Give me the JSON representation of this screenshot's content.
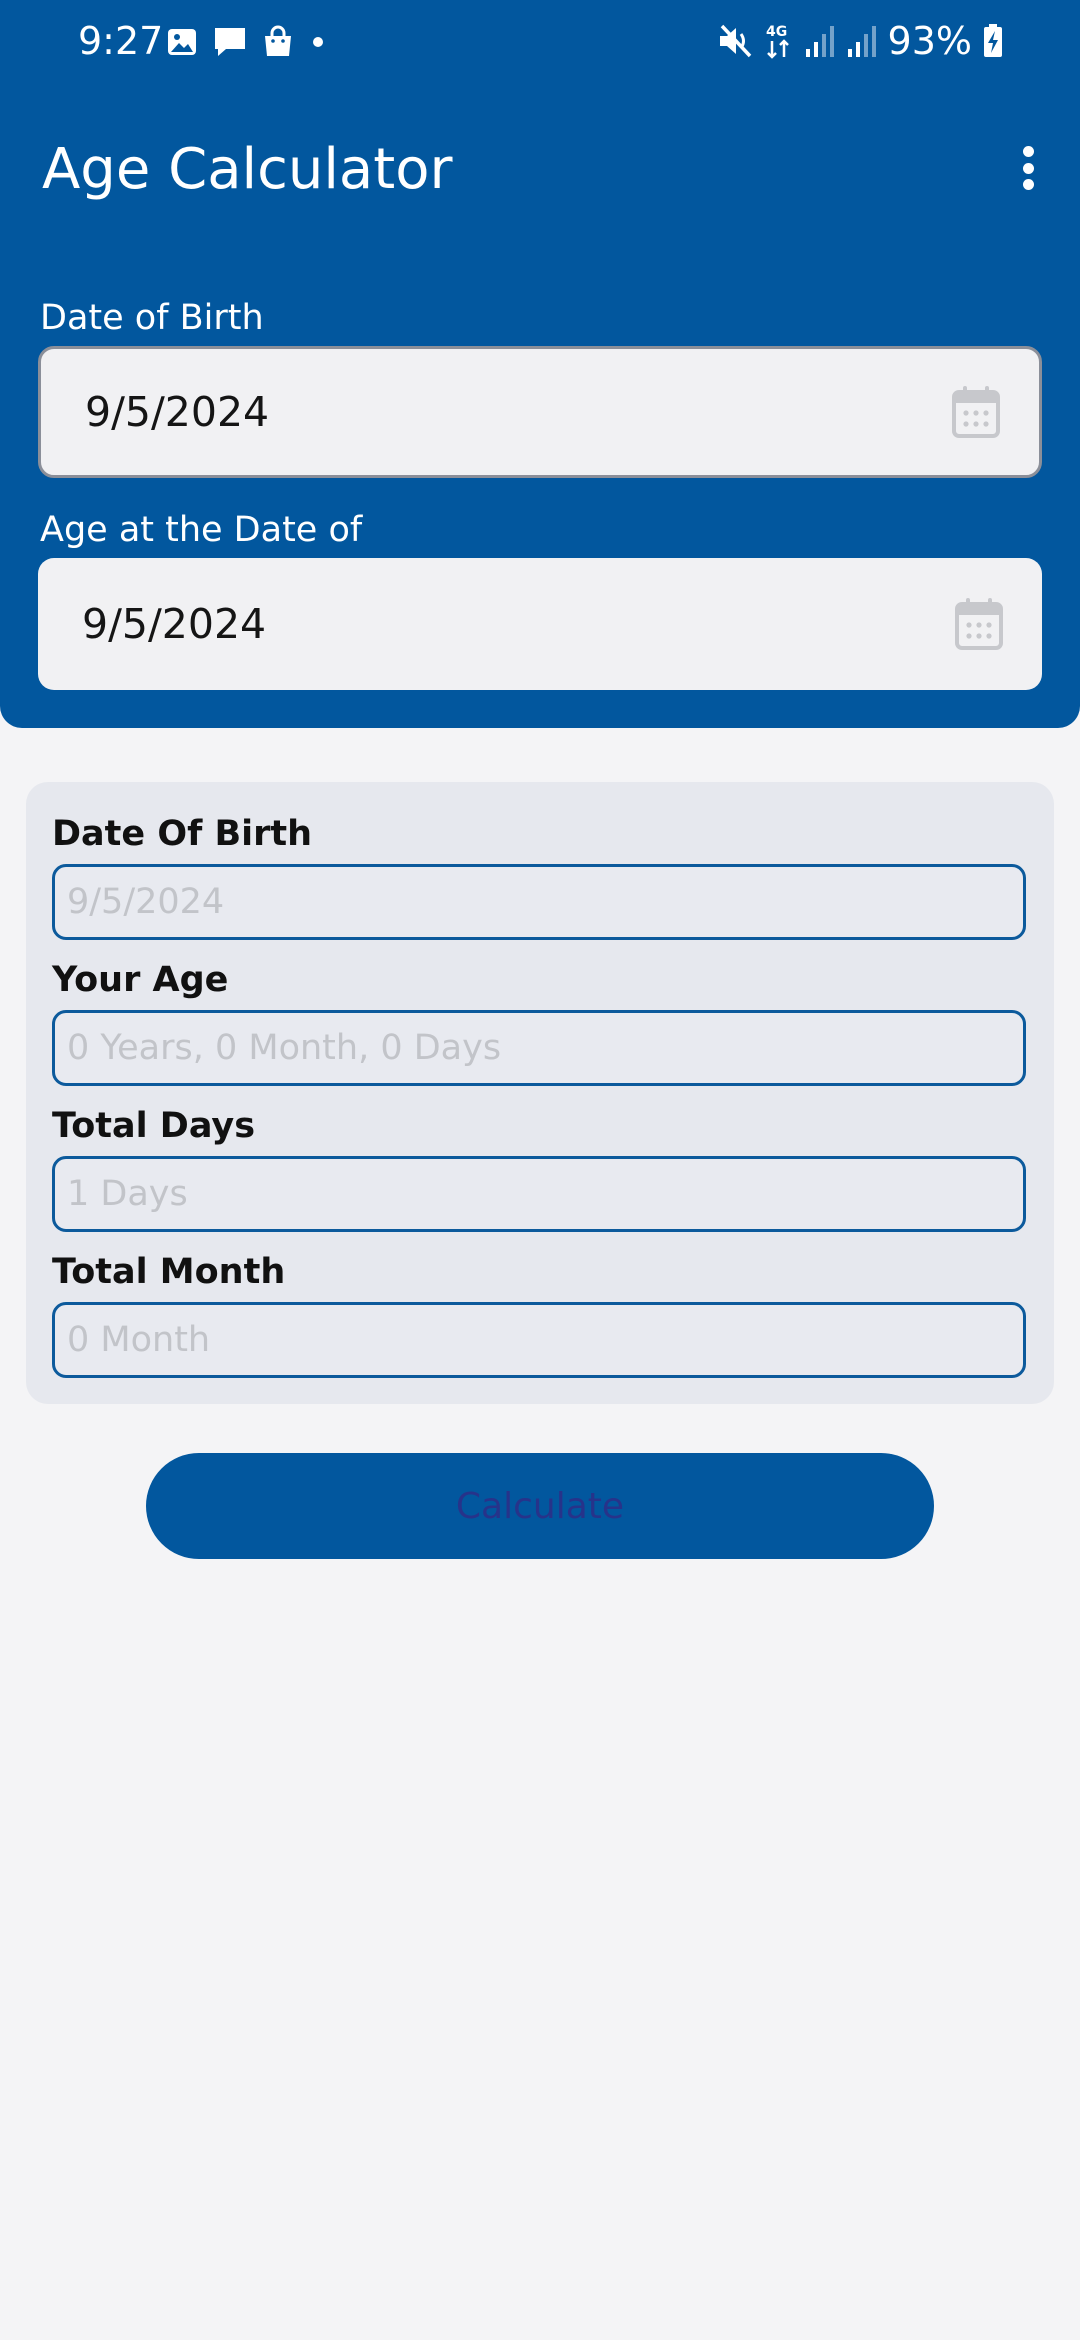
{
  "status_bar": {
    "time": "9:27",
    "battery": "93%"
  },
  "app_bar": {
    "title": "Age Calculator"
  },
  "inputs": {
    "dob_label": "Date of Birth",
    "dob_value": "9/5/2024",
    "age_at_label": "Age at the Date of",
    "age_at_value": "9/5/2024"
  },
  "results": {
    "dob_label": "Date Of Birth",
    "dob_placeholder": "9/5/2024",
    "age_label": "Your Age",
    "age_placeholder": "0 Years, 0 Month, 0 Days",
    "days_label": "Total Days",
    "days_placeholder": "1 Days",
    "month_label": "Total Month",
    "month_placeholder": "0 Month"
  },
  "actions": {
    "calculate_label": "Calculate"
  },
  "colors": {
    "primary": "#02579e",
    "background": "#f4f4f6",
    "card": "#e6e8ee",
    "field_border": "#0c5a9c",
    "placeholder": "#c2c4c9",
    "button_text": "#27338a"
  }
}
